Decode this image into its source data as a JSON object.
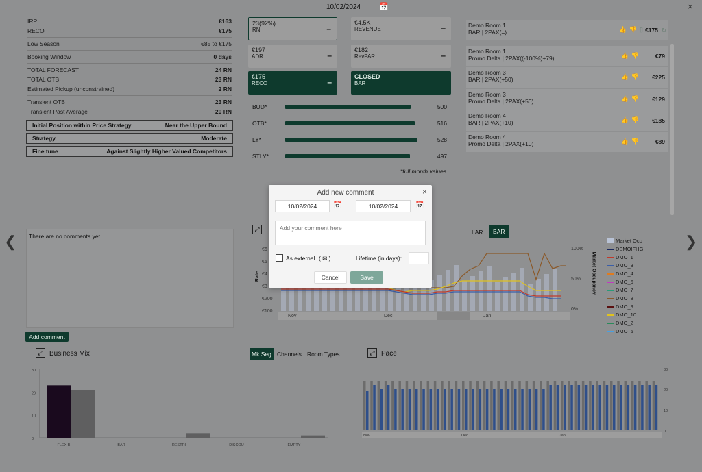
{
  "header": {
    "date": "10/02/2024"
  },
  "left_panel": {
    "irp": {
      "label": "IRP",
      "value": "€163"
    },
    "reco": {
      "label": "RECO",
      "value": "€175"
    },
    "low_season": {
      "label": "Low Season",
      "value": "€85 to €175"
    },
    "booking_window": {
      "label": "Booking Window",
      "value": "0 days"
    },
    "total_forecast": {
      "label": "TOTAL FORECAST",
      "value": "24 RN"
    },
    "total_otb": {
      "label": "TOTAL OTB",
      "value": "23 RN"
    },
    "est_pickup": {
      "label": "Estimated Pickup (unconstrained)",
      "value": "2 RN"
    },
    "transient_otb": {
      "label": "Transient OTB",
      "value": "23 RN"
    },
    "transient_past": {
      "label": "Transient Past Average",
      "value": "20 RN"
    },
    "initial_position": {
      "label": "Initial Position within Price Strategy",
      "value": "Near the Upper Bound"
    },
    "strategy": {
      "label": "Strategy",
      "value": "Moderate"
    },
    "fine_tune": {
      "label": "Fine tune",
      "value": "Against Slightly Higher Valued Competitors"
    }
  },
  "kpis": {
    "rn": {
      "value": "23(92%)",
      "label": "RN"
    },
    "revenue": {
      "value": "€4.5K",
      "label": "REVENUE"
    },
    "adr": {
      "value": "€197",
      "label": "ADR"
    },
    "revpar": {
      "value": "€182",
      "label": "RevPAR"
    },
    "reco": {
      "value": "€175",
      "label": "RECO"
    },
    "status": {
      "value": "CLOSED",
      "label": "BAR"
    },
    "dash": "–"
  },
  "bars": [
    {
      "label": "BUD*",
      "value": 500
    },
    {
      "label": "OTB*",
      "value": 516
    },
    {
      "label": "LY*",
      "value": 528
    },
    {
      "label": "STLY*",
      "value": 497
    }
  ],
  "bars_note": "*full month values",
  "rooms_header": {
    "name": "Demo Room 1",
    "rate": "BAR | 2PAX(=)",
    "price": "€175"
  },
  "rooms": [
    {
      "name": "Demo Room 1",
      "rate": "Promo Delta | 2PAX((-100%)+79)",
      "price": "€79"
    },
    {
      "name": "Demo Room 3",
      "rate": "BAR | 2PAX(+50)",
      "price": "€225"
    },
    {
      "name": "Demo Room 3",
      "rate": "Promo Delta | 2PAX(+50)",
      "price": "€129"
    },
    {
      "name": "Demo Room 4",
      "rate": "BAR | 2PAX(+10)",
      "price": "€185"
    },
    {
      "name": "Demo Room 4",
      "rate": "Promo Delta | 2PAX(+10)",
      "price": "€89"
    }
  ],
  "comments": {
    "empty_text": "There are no comments yet.",
    "add_button": "Add comment"
  },
  "modal": {
    "title": "Add new comment",
    "start_date": "10/02/2024",
    "end_date": "10/02/2024",
    "placeholder": "Add your comment here",
    "external_label": "As external",
    "lifetime_label": "Lifetime (in days):",
    "cancel": "Cancel",
    "save": "Save"
  },
  "rate_chart": {
    "tabs": [
      "LAR",
      "BAR"
    ],
    "ylabel": "Rate",
    "y2label": "Market Occupancy",
    "yticks": [
      "€6",
      "€5",
      "€4",
      "€3",
      "€200",
      "€100"
    ],
    "y2ticks": [
      "100%",
      "50%",
      "0%"
    ],
    "months": [
      "Nov",
      "Dec",
      "Jan"
    ],
    "legend": [
      "Market Occ",
      "DEMOIFHG",
      "DMO_1",
      "DMO_3",
      "DMO_4",
      "DMO_6",
      "DMO_7",
      "DMO_8",
      "DMO_9",
      "DMO_10",
      "DMO_2",
      "DMO_5"
    ],
    "legend_colors": [
      "#b9c3d6",
      "#1b2a5e",
      "#c0392b",
      "#3b5ea8",
      "#e07b1f",
      "#c03cc0",
      "#2a9a78",
      "#8b5a2b",
      "#5a1010",
      "#e0c21f",
      "#2a8a5a",
      "#4aa0e0"
    ]
  },
  "business_mix": {
    "title": "Business Mix",
    "tabs": [
      "Mk Seg",
      "Channels",
      "Room Types"
    ],
    "yticks": [
      "30",
      "20",
      "10",
      "0"
    ]
  },
  "pace": {
    "title": "Pace",
    "yticks": [
      "30",
      "20",
      "10",
      "0"
    ],
    "months": [
      "Nov",
      "Dec",
      "Jan"
    ]
  },
  "chart_data": [
    {
      "type": "bar",
      "title": "Business Mix",
      "categories": [
        "FLEX B",
        "BAR",
        "RESTRI",
        "DISCOU",
        "EMPTY"
      ],
      "series": [
        {
          "values": [
            23,
            0,
            0,
            0,
            0
          ],
          "color": "#1a0a1e"
        },
        {
          "values": [
            21,
            0,
            2,
            0,
            1
          ],
          "color": "#5f5f60"
        }
      ],
      "ylim": [
        0,
        30
      ]
    },
    {
      "type": "bar",
      "title": "Pace",
      "series": [
        {
          "values": [
            19,
            22,
            20,
            22,
            20,
            20,
            20,
            20,
            20,
            20,
            20,
            20,
            20,
            20,
            20,
            20,
            20,
            20,
            20,
            20,
            20,
            20,
            20,
            20,
            20,
            20,
            22,
            22,
            22,
            22,
            22,
            22,
            22,
            22,
            22,
            22,
            22,
            22,
            22,
            22,
            22,
            22
          ]
        },
        {
          "values": [
            24,
            24,
            24,
            24,
            24,
            24,
            24,
            24,
            24,
            24,
            24,
            24,
            24,
            24,
            24,
            24,
            24,
            24,
            24,
            24,
            24,
            24,
            24,
            24,
            24,
            24,
            24,
            24,
            24,
            24,
            24,
            24,
            24,
            24,
            24,
            24,
            24,
            24,
            24,
            24,
            24,
            24
          ]
        }
      ],
      "ylim": [
        0,
        30
      ]
    }
  ]
}
